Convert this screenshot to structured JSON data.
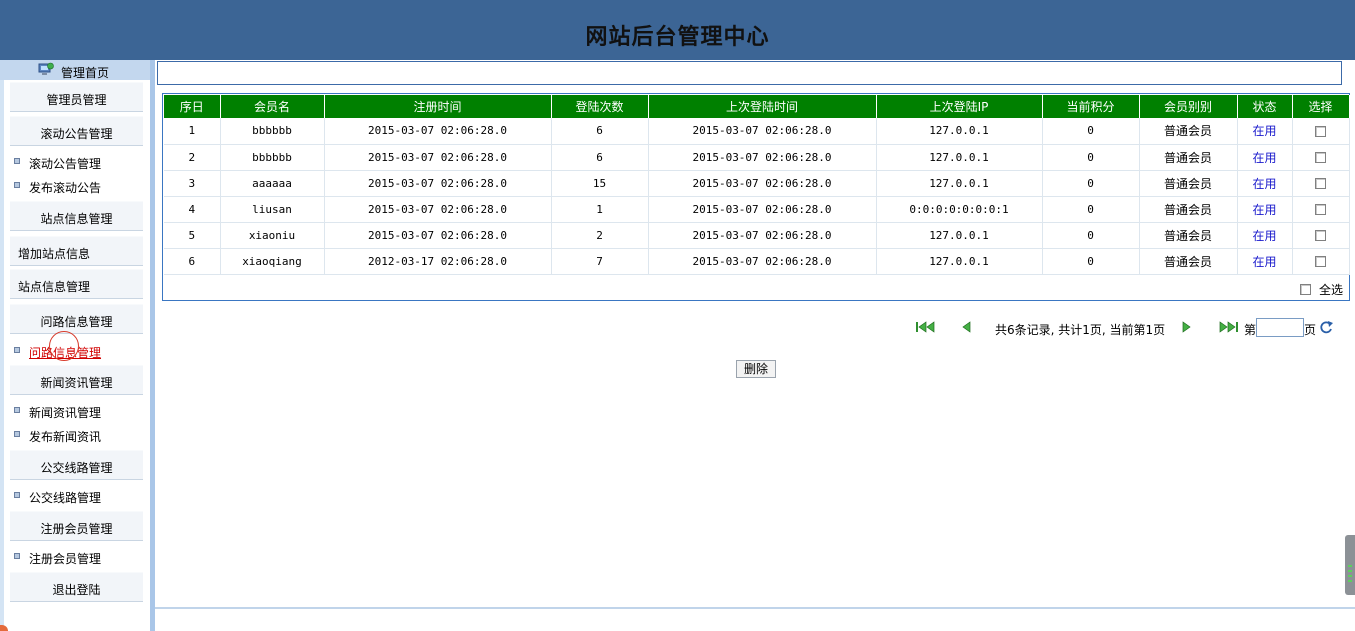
{
  "header": {
    "title": "网站后台管理中心"
  },
  "sidebar": {
    "home_label": "管理首页",
    "sections": [
      {
        "label": "管理员管理"
      },
      {
        "label": "滚动公告管理"
      },
      {
        "label": "站点信息管理"
      },
      {
        "label": "问路信息管理"
      },
      {
        "label": "新闻资讯管理"
      },
      {
        "label": "公交线路管理"
      },
      {
        "label": "注册会员管理"
      },
      {
        "label": "退出登陆"
      }
    ],
    "sub_items": {
      "notice_manage": "滚动公告管理",
      "notice_publish": "发布滚动公告",
      "site_add": "增加站点信息",
      "site_manage": "站点信息管理",
      "ask_manage": "问路信息管理",
      "news_manage": "新闻资讯管理",
      "news_publish": "发布新闻资讯",
      "bus_manage": "公交线路管理",
      "member_manage": "注册会员管理"
    }
  },
  "table": {
    "headers": [
      "序日",
      "会员名",
      "注册时间",
      "登陆次数",
      "上次登陆时间",
      "上次登陆IP",
      "当前积分",
      "会员别别",
      "状态",
      "选择"
    ],
    "rows": [
      {
        "no": "1",
        "name": "bbbbbb",
        "reg_time": "2015-03-07 02:06:28.0",
        "logins": "6",
        "last_login": "2015-03-07 02:06:28.0",
        "ip": "127.0.0.1",
        "points": "0",
        "level": "普通会员",
        "status": "在用"
      },
      {
        "no": "2",
        "name": "bbbbbb",
        "reg_time": "2015-03-07 02:06:28.0",
        "logins": "6",
        "last_login": "2015-03-07 02:06:28.0",
        "ip": "127.0.0.1",
        "points": "0",
        "level": "普通会员",
        "status": "在用"
      },
      {
        "no": "3",
        "name": "aaaaaa",
        "reg_time": "2015-03-07 02:06:28.0",
        "logins": "15",
        "last_login": "2015-03-07 02:06:28.0",
        "ip": "127.0.0.1",
        "points": "0",
        "level": "普通会员",
        "status": "在用"
      },
      {
        "no": "4",
        "name": "liusan",
        "reg_time": "2015-03-07 02:06:28.0",
        "logins": "1",
        "last_login": "2015-03-07 02:06:28.0",
        "ip": "0:0:0:0:0:0:0:1",
        "points": "0",
        "level": "普通会员",
        "status": "在用"
      },
      {
        "no": "5",
        "name": "xiaoniu",
        "reg_time": "2015-03-07 02:06:28.0",
        "logins": "2",
        "last_login": "2015-03-07 02:06:28.0",
        "ip": "127.0.0.1",
        "points": "0",
        "level": "普通会员",
        "status": "在用"
      },
      {
        "no": "6",
        "name": "xiaoqiang",
        "reg_time": "2012-03-17 02:06:28.0",
        "logins": "7",
        "last_login": "2015-03-07 02:06:28.0",
        "ip": "127.0.0.1",
        "points": "0",
        "level": "普通会员",
        "status": "在用"
      }
    ],
    "select_all_label": "全选"
  },
  "pager": {
    "info": "共6条记录, 共计1页, 当前第1页",
    "page_prefix": "第",
    "page_suffix": "页",
    "page_value": ""
  },
  "actions": {
    "delete_label": "删除"
  },
  "colors": {
    "header_bg": "#3c6595",
    "table_header_bg": "#008000",
    "sidebar_bg": "#d4e4f4",
    "status_link": "#1a1acc",
    "active_link": "#d10000"
  },
  "icons": {
    "home": "computer-globe-icon",
    "first": "first-page-icon",
    "prev": "prev-page-icon",
    "next": "next-page-icon",
    "last": "last-page-icon",
    "go": "refresh-go-icon"
  }
}
